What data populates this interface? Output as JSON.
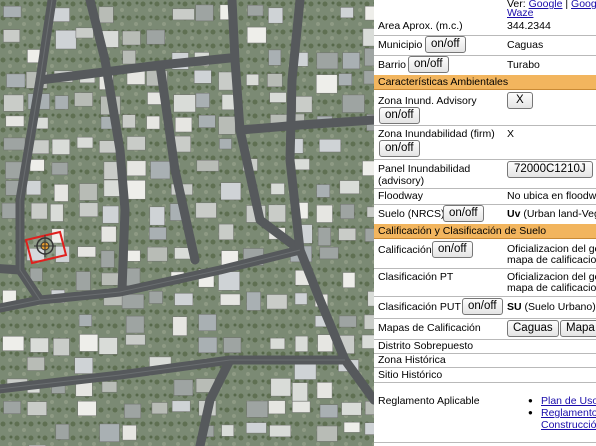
{
  "top_links": {
    "prefix": "Ver:",
    "google": "Google",
    "sep": " | ",
    "google2": "Googl",
    "waze": "Waze"
  },
  "area": {
    "label": "Area Aprox. (m.c.)",
    "value": "344.2344"
  },
  "municipio": {
    "label": "Municipio",
    "button": "on/off",
    "value": "Caguas"
  },
  "barrio": {
    "label": "Barrio",
    "button": "on/off",
    "value": "Turabo"
  },
  "sections": {
    "ambientales": "Características Ambientales",
    "calificacion": "Calificación y Clasificación de Suelo"
  },
  "zona_inund_advisory": {
    "label": "Zona Inund. Advisory",
    "button": "on/off",
    "value_button": "X"
  },
  "zona_inund_firm": {
    "label": "Zona Inundabilidad (firm)",
    "button": "on/off",
    "value": "X"
  },
  "panel_inund": {
    "label_line1": "Panel Inundabilidad",
    "label_line2": "(advisory)",
    "value_button": "72000C1210J"
  },
  "floodway": {
    "label": "Floodway",
    "value": "No ubica en floodw"
  },
  "suelo_nrcs": {
    "label": "Suelo (NRCS)",
    "button": "on/off",
    "value_bold": "Uv",
    "value_rest": " (Urban land-Veg"
  },
  "calificacion": {
    "label": "Calificación",
    "button": "on/off",
    "value_line1": "Oficializacion del ge",
    "value_line2": "mapa de calificacio"
  },
  "clasificacion_pt": {
    "label": "Clasificación PT",
    "value_line1": "Oficializacion del ge",
    "value_line2": "mapa de calificacio"
  },
  "clasificacion_put": {
    "label": "Clasificación PUT",
    "button": "on/off",
    "value_bold": "SU",
    "value_rest": " (Suelo Urbano)"
  },
  "mapas_calificacion": {
    "label": "Mapas de Calificación",
    "buttons": [
      "Caguas",
      "Mapa"
    ]
  },
  "distrito_sobrepuesto": {
    "label": "Distrito Sobrepuesto"
  },
  "zona_historica": {
    "label": "Zona Histórica"
  },
  "sitio_historico": {
    "label": "Sitio Histórico"
  },
  "reglamento": {
    "label": "Reglamento Aplicable",
    "links": [
      "Plan de Uso",
      "Reglamento",
      "Construcció"
    ]
  },
  "colors": {
    "section_bg": "#f2b55e",
    "link": "#1a0dab",
    "parcel_outline": "#e0201e"
  }
}
